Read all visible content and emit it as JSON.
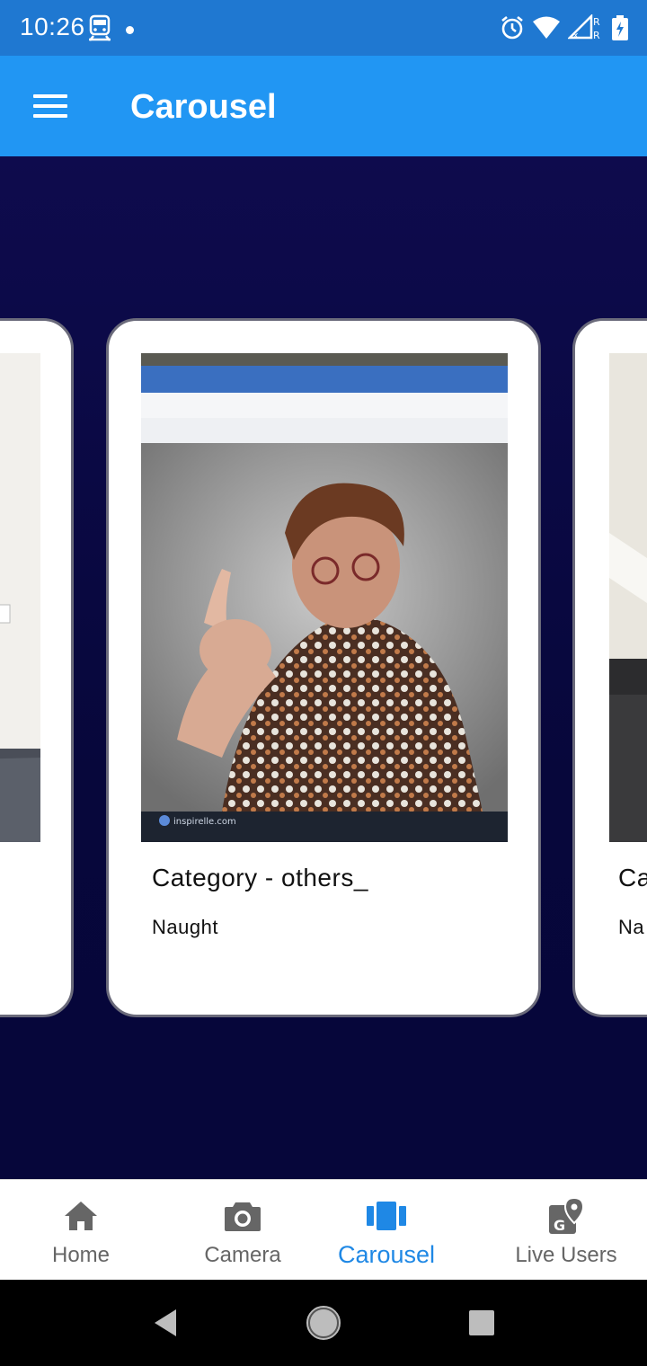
{
  "status_bar": {
    "time": "10:26"
  },
  "app_bar": {
    "title": "Carousel"
  },
  "carousel": {
    "cards": [
      {
        "title": "",
        "subtitle": ""
      },
      {
        "title": "Category - others_",
        "subtitle": "Naught"
      },
      {
        "title": "Ca",
        "subtitle": "Na"
      }
    ]
  },
  "bottom_nav": {
    "items": [
      {
        "label": "Home",
        "icon": "home-icon",
        "active": false
      },
      {
        "label": "Camera",
        "icon": "camera-icon",
        "active": false
      },
      {
        "label": "Carousel",
        "icon": "carousel-icon",
        "active": true
      },
      {
        "label": "Live Users",
        "icon": "location-map-icon",
        "active": false
      }
    ]
  },
  "colors": {
    "status_bar": "#1f78d1",
    "app_bar": "#2196f3",
    "background": "#0a0a3a",
    "active_nav": "#1f88e5",
    "inactive_nav": "#666666"
  }
}
